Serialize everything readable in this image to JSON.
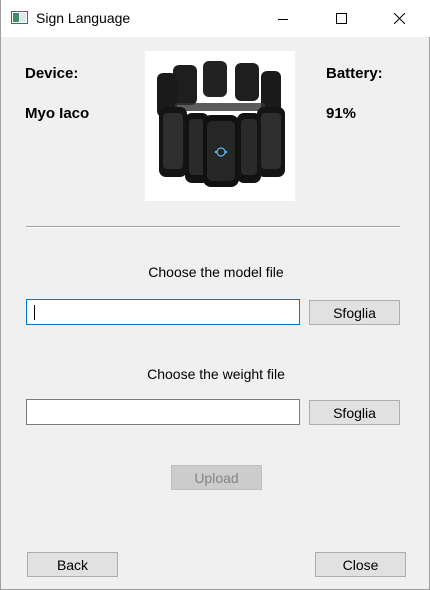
{
  "window": {
    "title": "Sign Language",
    "controls": [
      "minimize-icon",
      "maximize-icon",
      "close-icon"
    ]
  },
  "device": {
    "label": "Device:",
    "value": "Myo Iaco",
    "image_icon": "myo-armband-image"
  },
  "battery": {
    "label": "Battery:",
    "value": "91%"
  },
  "model": {
    "caption": "Choose the model file",
    "value": "",
    "browse_label": "Sfoglia"
  },
  "weight": {
    "caption": "Choose the weight file",
    "value": "",
    "browse_label": "Sfoglia"
  },
  "actions": {
    "upload_label": "Upload",
    "back_label": "Back",
    "close_label": "Close"
  },
  "colors": {
    "window_bg": "#f0f0f0",
    "focus_border": "#0078d7",
    "button_bg": "#e1e1e1",
    "disabled_text": "#838383"
  }
}
